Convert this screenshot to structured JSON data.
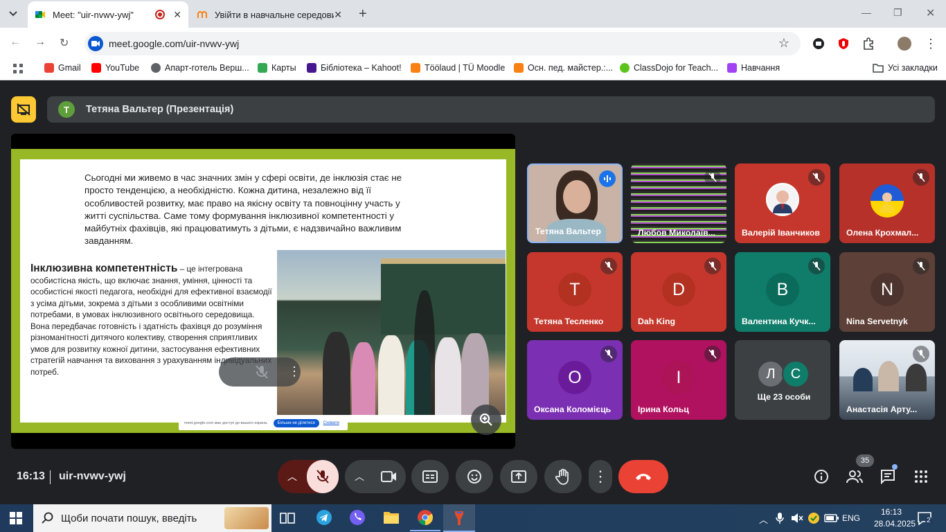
{
  "browser": {
    "tabs": [
      {
        "label": "Meet: \"uir-nvwv-ywj\"",
        "active": true
      },
      {
        "label": "Увійти в навчальне середовищ",
        "active": false
      }
    ],
    "url": "meet.google.com/uir-nvwv-ywj",
    "bookmarks": [
      {
        "label": "Gmail",
        "color": "#ea4335"
      },
      {
        "label": "YouTube",
        "color": "#ff0000"
      },
      {
        "label": "Апарт-готель Верш...",
        "color": "#5f6368"
      },
      {
        "label": "Карты",
        "color": "#34a853"
      },
      {
        "label": "Бібліотека – Kahoot!",
        "color": "#46178f"
      },
      {
        "label": "Töölaud | TÜ Moodle",
        "color": "#f98012"
      },
      {
        "label": "Осн. пед. майстер.:...",
        "color": "#f98012"
      },
      {
        "label": "ClassDojo for Teach...",
        "color": "#5cc31d"
      },
      {
        "label": "Навчання",
        "color": "#a142f4"
      }
    ],
    "all_bookmarks": "Усі закладки"
  },
  "meet": {
    "presenter": {
      "initial": "T",
      "name": "Тетяна Вальтер (Презентація)"
    },
    "slide": {
      "intro": "Сьогодні ми живемо в час значних змін у сфері освіти, де інклюзія стає не просто тенденцією, а необхідністю. Кожна дитина, незалежно від її особливостей розвитку, має право на якісну освіту та повноцінну участь у житті суспільства. Саме тому формування інклюзивної компетентності у майбутніх фахівців, які працюватимуть з дітьми, є надзвичайно важливим завданням.",
      "def_title": "Інклюзивна компетентність",
      "def_body": " – це інтегрована особистісна якість, що включає знання, уміння, цінності та особистісні якості педагога, необхідні для ефективної взаємодії з усіма дітьми, зокрема з дітьми з особливими освітніми потребами, в умовах інклюзивного освітнього середовища. Вона передбачає готовність і здатність фахівця до розуміння різноманітності дитячого колективу, створення сприятливих умов для розвитку кожної дитини, застосування ефективних стратегій навчання та виховання з урахуванням індивідуальних потреб."
    },
    "share_bar": {
      "text": "meet.google.com має доступ до вашого екрана.",
      "stop": "Більше не ділитися",
      "hide": "Сховати"
    },
    "tiles": [
      {
        "name": "Тетяна Вальтер",
        "initial": "",
        "bg": "#c9b3a6",
        "type": "video-speaking"
      },
      {
        "name": "Любов Миколаїв...",
        "initial": "",
        "bg": "#3a3a3a",
        "type": "glitch"
      },
      {
        "name": "Валерій Іванчиков",
        "initial": "",
        "bg": "#c5372c",
        "type": "avatar-photo"
      },
      {
        "name": "Олена Крохмал...",
        "initial": "",
        "bg": "#b5312a",
        "type": "avatar-photo"
      },
      {
        "name": "Тетяна Тесленко",
        "initial": "T",
        "bg": "#c5372c",
        "type": "initial",
        "avatar": "#b23121"
      },
      {
        "name": "Dah King",
        "initial": "D",
        "bg": "#c5372c",
        "type": "initial",
        "avatar": "#b23121"
      },
      {
        "name": "Валентина Кучк...",
        "initial": "B",
        "bg": "#0f7d6a",
        "type": "initial",
        "avatar": "#0b6b5a"
      },
      {
        "name": "Nina Servetnyk",
        "initial": "N",
        "bg": "#5d4037",
        "type": "initial",
        "avatar": "#4e342e"
      },
      {
        "name": "Оксана Коломієць",
        "initial": "O",
        "bg": "#7b2fb3",
        "type": "initial",
        "avatar": "#6a1b9a"
      },
      {
        "name": "Ірина Кольц",
        "initial": "I",
        "bg": "#b0125f",
        "type": "initial",
        "avatar": "#ad1457"
      },
      {
        "name": "Ще 23 особи",
        "initial": "",
        "bg": "#3c4043",
        "type": "more",
        "more_initials": [
          "Л",
          "C"
        ]
      },
      {
        "name": "Анастасія Арту...",
        "initial": "",
        "bg": "#7d8b9a",
        "type": "video"
      }
    ],
    "time": "16:13",
    "meeting_code": "uir-nvwv-ywj",
    "participants_count": "35"
  },
  "taskbar": {
    "search_placeholder": "Щоби почати пошук, введіть",
    "lang": "ENG",
    "time": "16:13",
    "date": "28.04.2025",
    "notifications": "2"
  }
}
